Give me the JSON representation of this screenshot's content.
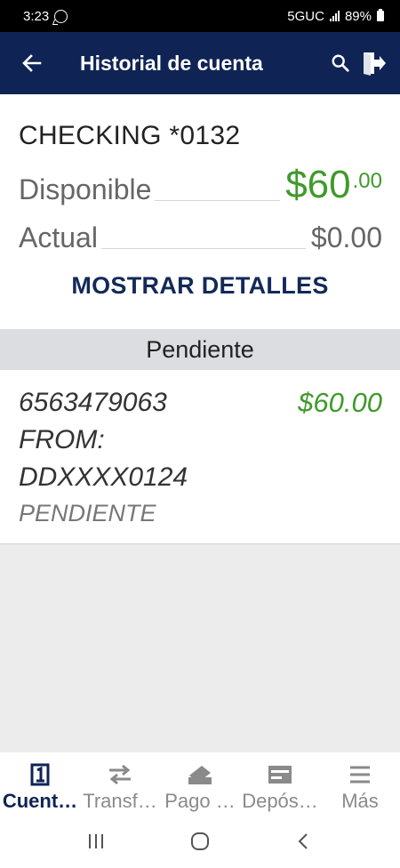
{
  "status": {
    "time": "3:23",
    "network": "5GUC",
    "battery": "89%"
  },
  "header": {
    "title": "Historial de cuenta"
  },
  "account": {
    "name": "CHECKING *0132",
    "available_label": "Disponible",
    "available_amount": "$60",
    "available_cents": ".00",
    "current_label": "Actual",
    "current_amount": "$0.00",
    "details_button": "MOSTRAR DETALLES"
  },
  "pending": {
    "header": "Pendiente",
    "items": [
      {
        "description_line1": "6563479063",
        "description_line2": "FROM:",
        "description_line3": "DDXXXX0124",
        "amount": "$60.00",
        "status": "PENDIENTE"
      }
    ]
  },
  "bottom_nav": [
    {
      "label": "Cuent…",
      "icon": "account-1-icon",
      "active": true
    },
    {
      "label": "Transf…",
      "icon": "transfer-arrows-icon",
      "active": false
    },
    {
      "label": "Pago …",
      "icon": "pay-bill-icon",
      "active": false
    },
    {
      "label": "Depós…",
      "icon": "deposit-check-icon",
      "active": false
    },
    {
      "label": "Más",
      "icon": "menu-icon",
      "active": false
    }
  ],
  "colors": {
    "app_bar": "#0f2454",
    "positive": "#3f9a2b",
    "section_header": "#dcdde1"
  }
}
